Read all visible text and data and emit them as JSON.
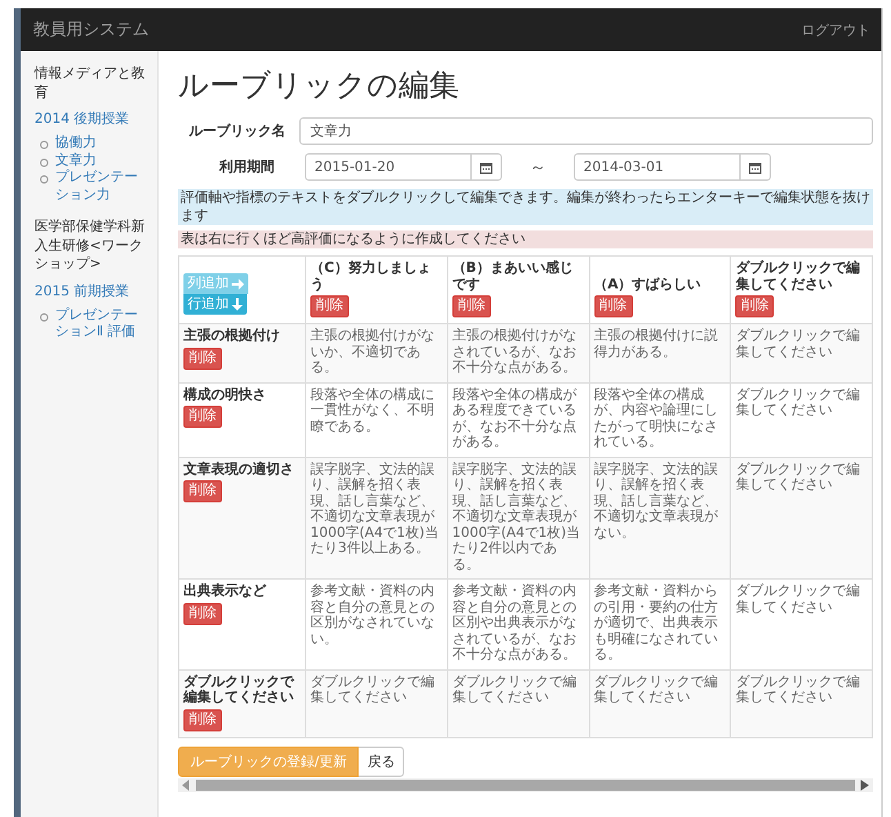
{
  "navbar": {
    "title": "教員用システム",
    "logout": "ログアウト"
  },
  "sidebar": {
    "sections": [
      {
        "title": "情報メディアと教育",
        "terms": [
          {
            "label": "2014 後期授業",
            "items": [
              "協働力",
              "文章力",
              "プレゼンテーション力"
            ]
          }
        ]
      },
      {
        "title": "医学部保健学科新入生研修<ワークショップ>",
        "terms": [
          {
            "label": "2015 前期授業",
            "items": [
              "プレゼンテーションⅡ 評価"
            ]
          }
        ]
      }
    ]
  },
  "page": {
    "title": "ルーブリックの編集",
    "name_label": "ルーブリック名",
    "name_value": "文章力",
    "period_label": "利用期間",
    "start_date": "2015-01-20",
    "separator": "～",
    "end_date": "2014-03-01",
    "notices": [
      {
        "kind": "info",
        "text": "評価軸や指標のテキストをダブルクリックして編集できます。編集が終わったらエンターキーで編集状態を抜けます"
      },
      {
        "kind": "danger",
        "text": "表は右に行くほど高評価になるように作成してください"
      }
    ]
  },
  "table": {
    "add_column": "列追加",
    "add_row": "行追加",
    "columns": [
      {
        "label": "（C）努力しましょう",
        "delete": "削除"
      },
      {
        "label": "（B）まあいい感じです",
        "delete": "削除"
      },
      {
        "label": "（A）すばらしい",
        "delete": "削除"
      },
      {
        "label": "ダブルクリックで編集してください",
        "delete": "削除"
      }
    ],
    "rows": [
      {
        "criterion": "主張の根拠付け",
        "delete": "削除",
        "cells": [
          "主張の根拠付けがないか、不適切である。",
          "主張の根拠付けがなされているが、なお不十分な点がある。",
          "主張の根拠付けに説得力がある。",
          "ダブルクリックで編集してください"
        ]
      },
      {
        "criterion": "構成の明快さ",
        "delete": "削除",
        "cells": [
          "段落や全体の構成に一貫性がなく、不明瞭である。",
          "段落や全体の構成がある程度できているが、なお不十分な点がある。",
          "段落や全体の構成が、内容や論理にしたがって明快になされている。",
          "ダブルクリックで編集してください"
        ]
      },
      {
        "criterion": "文章表現の適切さ",
        "delete": "削除",
        "cells": [
          "誤字脱字、文法的誤り、誤解を招く表現、話し言葉など、不適切な文章表現が1000字(A4で1枚)当たり3件以上ある。",
          "誤字脱字、文法的誤り、誤解を招く表現、話し言葉など、不適切な文章表現が1000字(A4で1枚)当たり2件以内である。",
          "誤字脱字、文法的誤り、誤解を招く表現、話し言葉など、不適切な文章表現がない。",
          "ダブルクリックで編集してください"
        ]
      },
      {
        "criterion": "出典表示など",
        "delete": "削除",
        "cells": [
          "参考文献・資料の内容と自分の意見との区別がなされていない。",
          "参考文献・資料の内容と自分の意見との区別や出典表示がなされているが、なお不十分な点がある。",
          "参考文献・資料からの引用・要約の仕方が適切で、出典表示も明確になされている。",
          "ダブルクリックで編集してください"
        ]
      },
      {
        "criterion": "ダブルクリックで編集してください",
        "delete": "削除",
        "cells": [
          "ダブルクリックで編集してください",
          "ダブルクリックで編集してください",
          "ダブルクリックで編集してください",
          "ダブルクリックで編集してください"
        ]
      }
    ]
  },
  "actions": {
    "submit": "ルーブリックの登録/更新",
    "back": "戻る"
  }
}
